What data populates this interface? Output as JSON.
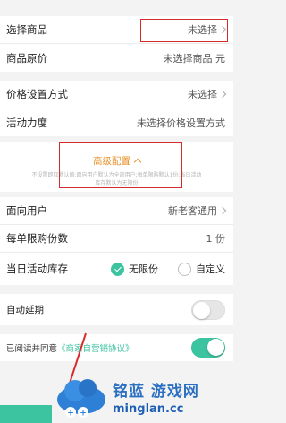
{
  "section1": {
    "rows": [
      {
        "label": "选择商品",
        "value": "未选择"
      },
      {
        "label": "商品原价",
        "value": "未选择商品 元"
      }
    ]
  },
  "section2": {
    "rows": [
      {
        "label": "价格设置方式",
        "value": "未选择"
      },
      {
        "label": "活动力度",
        "value": "未选择价格设置方式"
      }
    ]
  },
  "advanced": {
    "title": "高级配置",
    "note_line1": "不设置即取默认值:面向用户默认为全部用户;每单限购默认1份;当日活动",
    "note_line2": "库存默认为无限份"
  },
  "section3": {
    "audience": {
      "label": "面向用户",
      "value": "新老客通用"
    },
    "limit": {
      "label": "每单限购份数",
      "value": "1 份"
    },
    "stock": {
      "label": "当日活动库存",
      "option_unlimited": "无限份",
      "option_custom": "自定义",
      "selected": "无限份"
    }
  },
  "auto_extend": {
    "label": "自动延期",
    "enabled": false
  },
  "agreement": {
    "prefix": "已阅读并同意",
    "link": "《商家自营销协议》",
    "enabled": true
  },
  "watermark": {
    "cn": "铭蓝 游戏网",
    "en": "minglan.cc"
  },
  "colors": {
    "accent": "#3cc3a0",
    "highlight": "#d72b2b",
    "advanced": "#e8932b"
  }
}
